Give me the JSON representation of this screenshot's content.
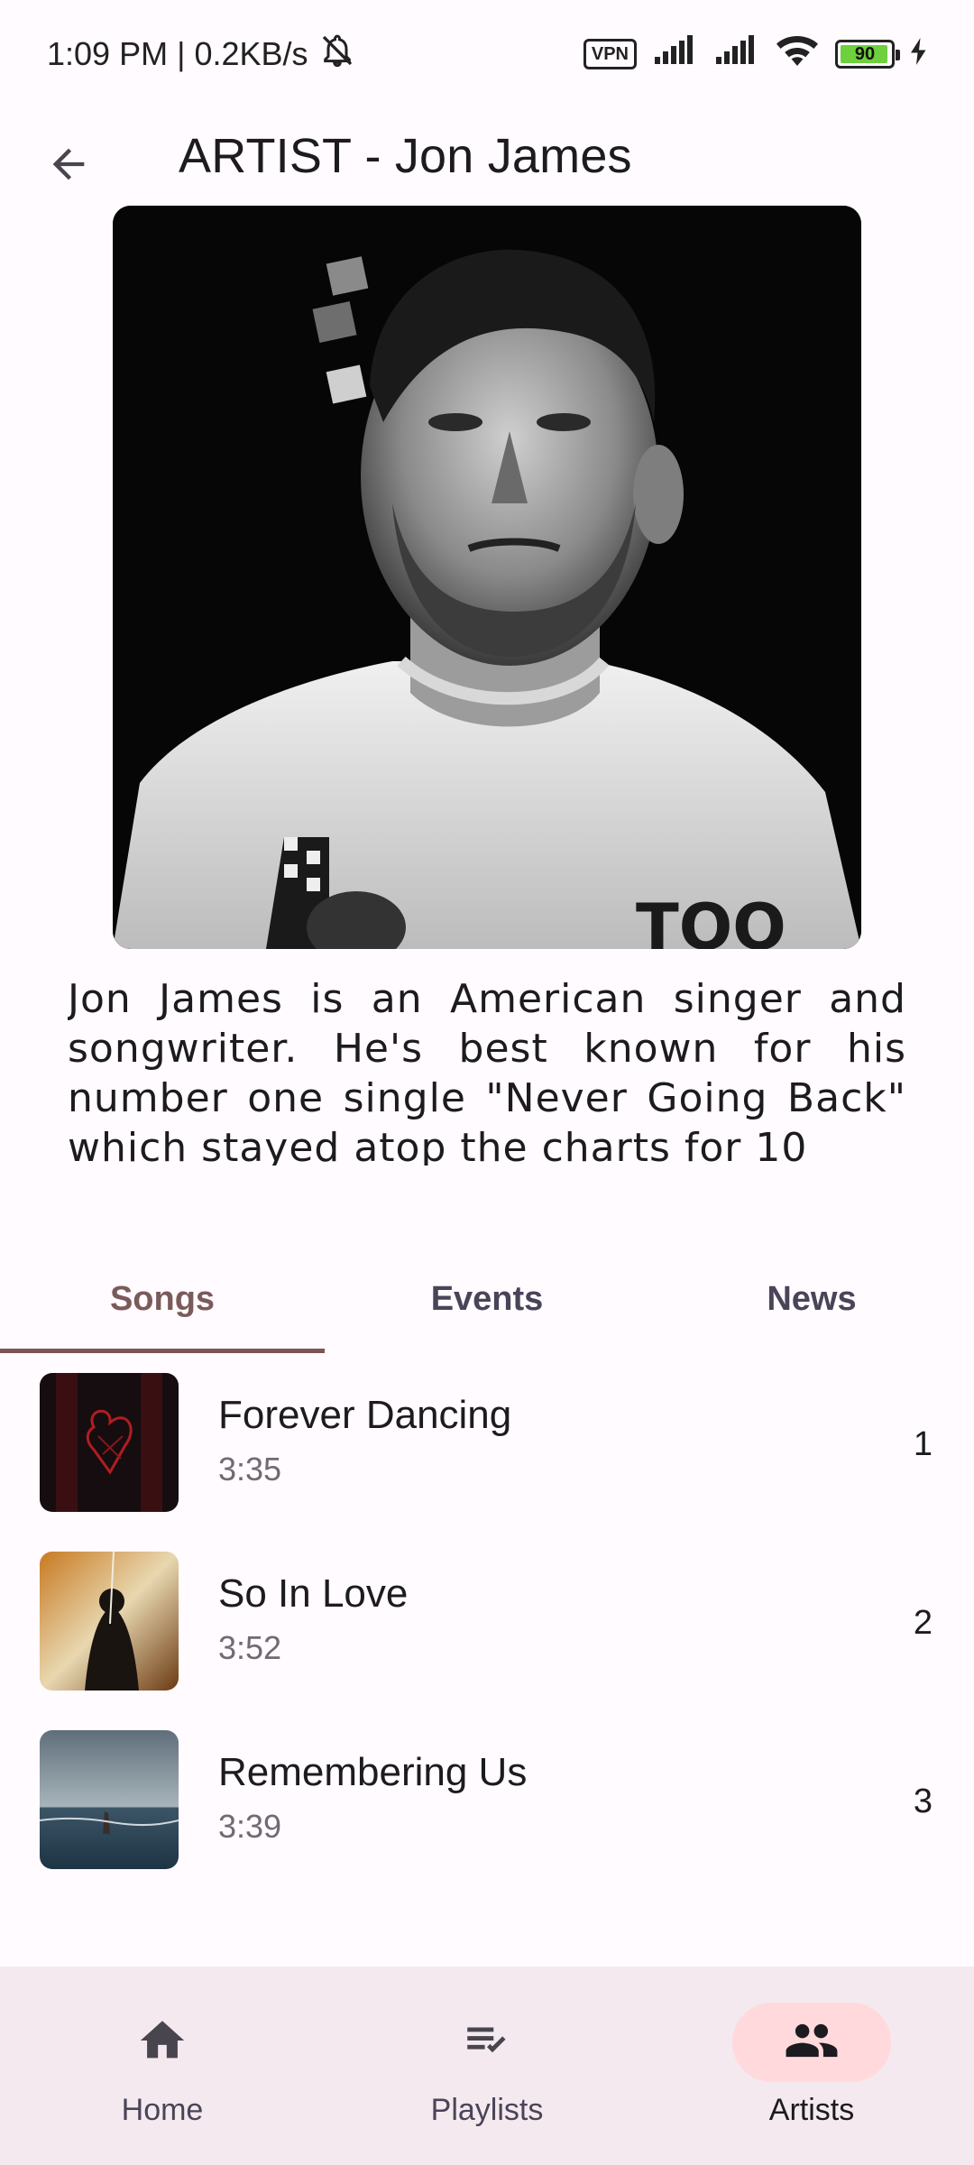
{
  "status_bar": {
    "time": "1:09 PM",
    "separator": "|",
    "speed": "0.2KB/s",
    "vpn_label": "VPN",
    "battery": "90"
  },
  "header": {
    "title": "ARTIST - Jon James"
  },
  "artist": {
    "bio": "Jon James is an American singer and songwriter. He's best known for his number one single \"Never Going Back\" which stayed atop the charts for 10"
  },
  "tabs": [
    {
      "label": "Songs",
      "active": true
    },
    {
      "label": "Events",
      "active": false
    },
    {
      "label": "News",
      "active": false
    }
  ],
  "songs": [
    {
      "title": "Forever Dancing",
      "duration": "3:35",
      "number": "1"
    },
    {
      "title": "So In Love",
      "duration": "3:52",
      "number": "2"
    },
    {
      "title": "Remembering Us",
      "duration": "3:39",
      "number": "3"
    }
  ],
  "bottom_nav": [
    {
      "label": "Home",
      "icon": "home-icon",
      "active": false
    },
    {
      "label": "Playlists",
      "icon": "playlist-check-icon",
      "active": false
    },
    {
      "label": "Artists",
      "icon": "people-icon",
      "active": true
    }
  ],
  "colors": {
    "accent": "#7d5555",
    "nav_active_pill": "#ffd9dc",
    "nav_background": "#f4e9ee",
    "background": "#fffbfe"
  }
}
